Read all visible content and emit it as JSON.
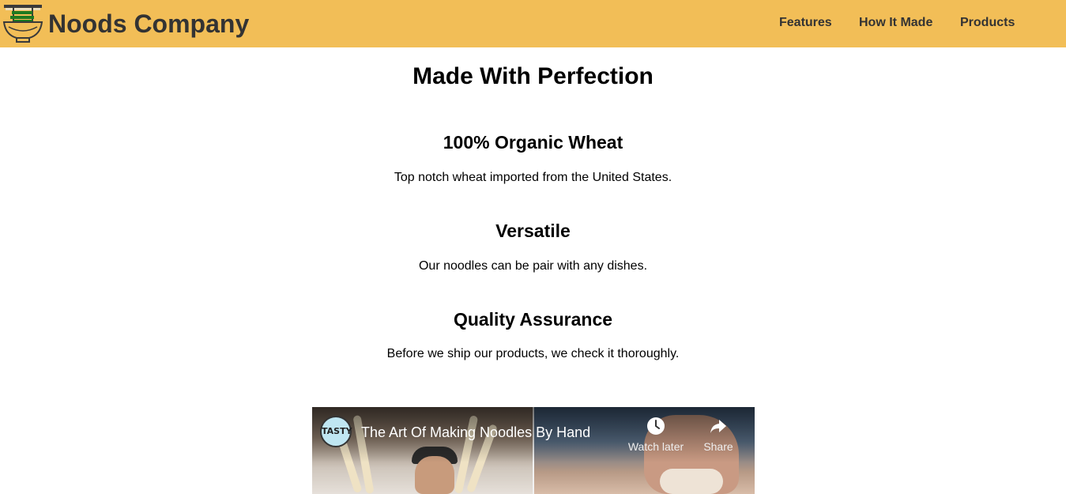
{
  "header": {
    "brand": "Noods Company",
    "nav": [
      "Features",
      "How It Made",
      "Products"
    ],
    "logo_icon": "noodle-bowl-icon",
    "background_color": "#f2be57"
  },
  "main": {
    "title": "Made With Perfection",
    "features": [
      {
        "title": "100% Organic Wheat",
        "description": "Top notch wheat imported from the United States."
      },
      {
        "title": "Versatile",
        "description": "Our noodles can be pair with any dishes."
      },
      {
        "title": "Quality Assurance",
        "description": "Before we ship our products, we check it thoroughly."
      }
    ]
  },
  "video": {
    "channel": "TASTY",
    "title": "The Art Of Making Noodles By Hand",
    "watch_later": "Watch later",
    "share": "Share"
  }
}
